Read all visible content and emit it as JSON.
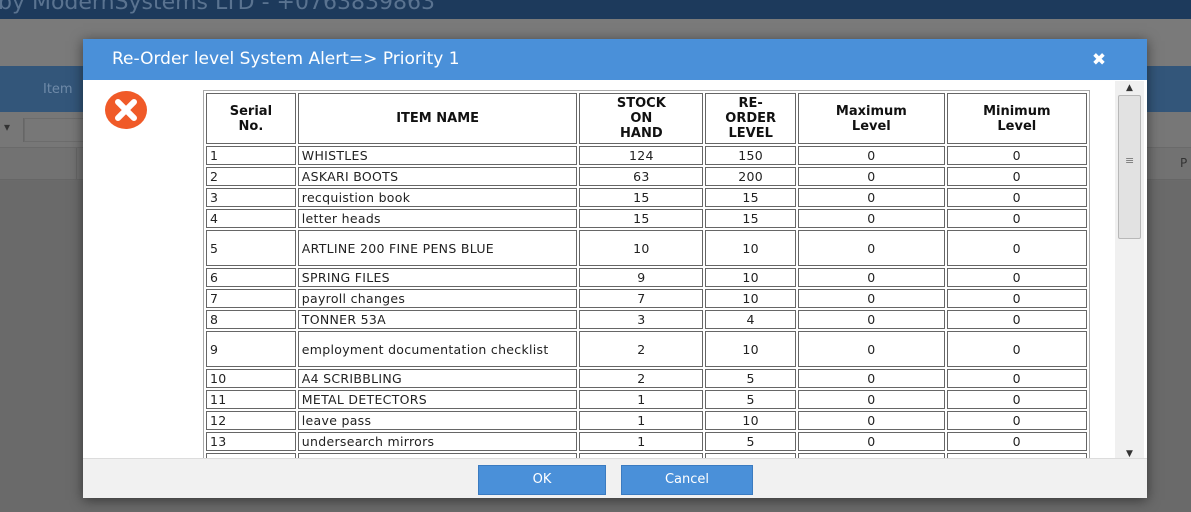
{
  "background": {
    "header_text": "by ModernSystems LTD - +0763839863",
    "tab_text": "Item",
    "grid_column_text": "P"
  },
  "dialog": {
    "title": "Re-Order level System Alert=> Priority 1",
    "close_glyph": "✖",
    "icon": "error-x-icon",
    "ok_label": "OK",
    "cancel_label": "Cancel"
  },
  "table": {
    "headers": {
      "serial": [
        "Serial",
        "No."
      ],
      "name": [
        "ITEM NAME"
      ],
      "stock": [
        "STOCK",
        "ON",
        "HAND"
      ],
      "reorder": [
        "RE-",
        "ORDER",
        "LEVEL"
      ],
      "max": [
        "Maximum",
        "Level"
      ],
      "min": [
        "Minimum",
        "Level"
      ]
    },
    "rows": [
      {
        "serial": "1",
        "name": "WHISTLES",
        "stock": "124",
        "reorder": "150",
        "max": "0",
        "min": "0"
      },
      {
        "serial": "2",
        "name": "ASKARI BOOTS",
        "stock": "63",
        "reorder": "200",
        "max": "0",
        "min": "0"
      },
      {
        "serial": "3",
        "name": "recquistion book",
        "stock": "15",
        "reorder": "15",
        "max": "0",
        "min": "0"
      },
      {
        "serial": "4",
        "name": "letter heads",
        "stock": "15",
        "reorder": "15",
        "max": "0",
        "min": "0"
      },
      {
        "serial": "5",
        "name": "ARTLINE 200 FINE PENS BLUE",
        "stock": "10",
        "reorder": "10",
        "max": "0",
        "min": "0"
      },
      {
        "serial": "6",
        "name": "SPRING FILES",
        "stock": "9",
        "reorder": "10",
        "max": "0",
        "min": "0"
      },
      {
        "serial": "7",
        "name": "payroll changes",
        "stock": "7",
        "reorder": "10",
        "max": "0",
        "min": "0"
      },
      {
        "serial": "8",
        "name": "TONNER 53A",
        "stock": "3",
        "reorder": "4",
        "max": "0",
        "min": "0"
      },
      {
        "serial": "9",
        "name": "employment documentation checklist",
        "stock": "2",
        "reorder": "10",
        "max": "0",
        "min": "0"
      },
      {
        "serial": "10",
        "name": "A4 SCRIBBLING",
        "stock": "2",
        "reorder": "5",
        "max": "0",
        "min": "0"
      },
      {
        "serial": "11",
        "name": "METAL DETECTORS",
        "stock": "1",
        "reorder": "5",
        "max": "0",
        "min": "0"
      },
      {
        "serial": "12",
        "name": "leave pass",
        "stock": "1",
        "reorder": "10",
        "max": "0",
        "min": "0"
      },
      {
        "serial": "13",
        "name": "undersearch mirrors",
        "stock": "1",
        "reorder": "5",
        "max": "0",
        "min": "0"
      }
    ]
  },
  "colors": {
    "titlebar": "#4a90d9",
    "button": "#4a90d9",
    "alert_icon": "#f05a28"
  }
}
